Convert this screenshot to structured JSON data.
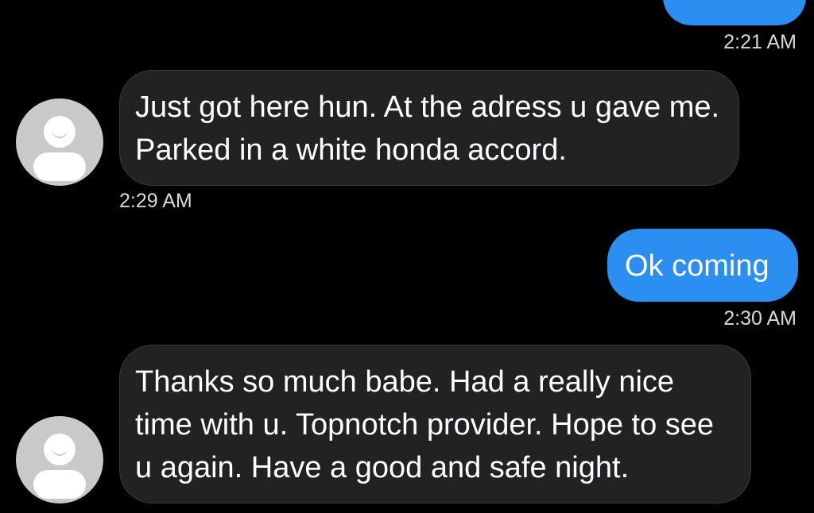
{
  "colors": {
    "background": "#000000",
    "sent_bubble": "#2a8ff0",
    "received_bubble": "#222224",
    "timestamp": "#d8d8d8",
    "avatar": "#c9c9cc"
  },
  "messages": [
    {
      "direction": "sent",
      "text": "",
      "time": "2:21 AM",
      "avatar_icon": ""
    },
    {
      "direction": "received",
      "text": "Just got here hun. At the adress u gave me. Parked in a white honda accord.",
      "time": "2:29 AM",
      "avatar_icon": "default-user-avatar-icon"
    },
    {
      "direction": "sent",
      "text": "Ok coming",
      "time": "2:30 AM",
      "avatar_icon": ""
    },
    {
      "direction": "received",
      "text": "Thanks so much babe. Had a really nice time with u. Topnotch provider. Hope to see u again. Have a good and safe night.",
      "time": "",
      "avatar_icon": "default-user-avatar-icon"
    }
  ]
}
